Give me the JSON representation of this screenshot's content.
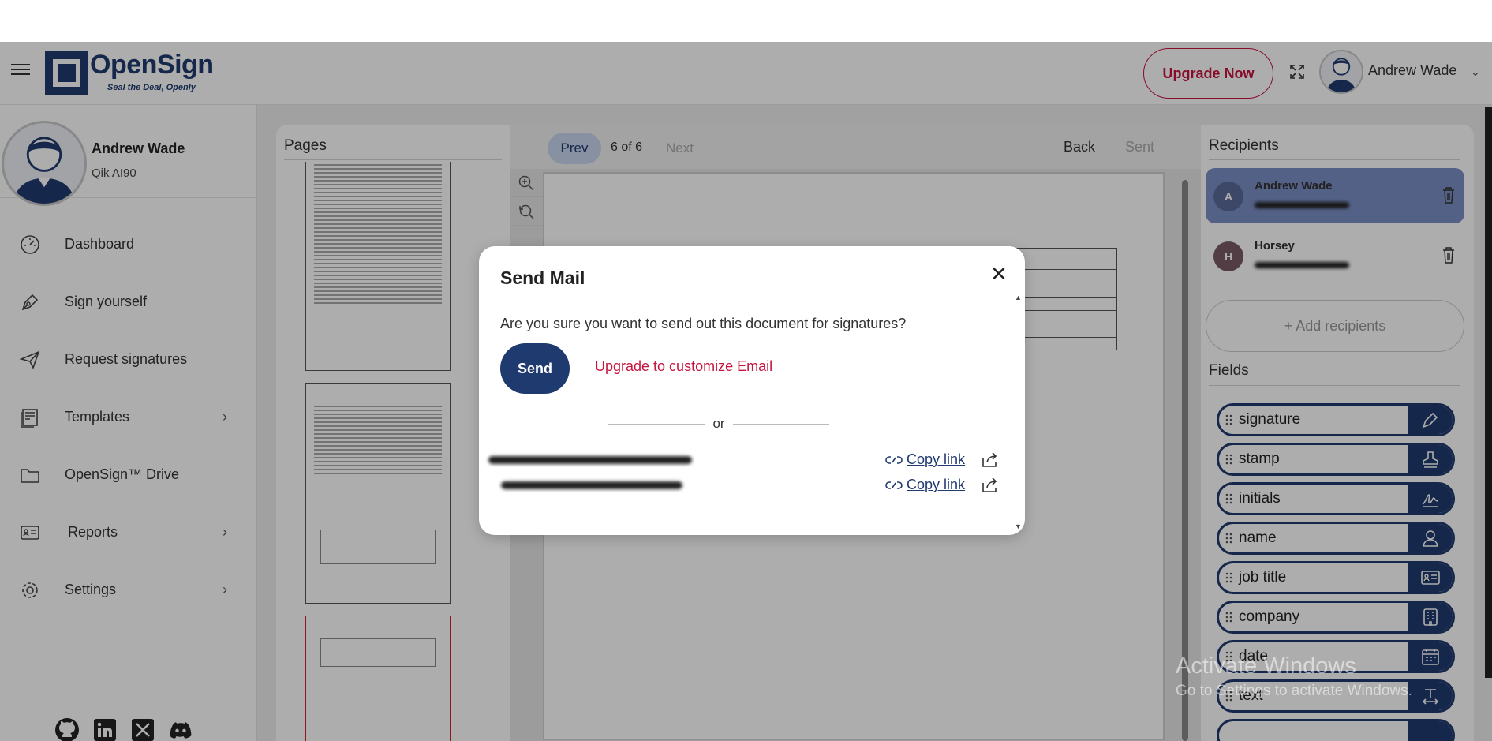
{
  "app": {
    "logo_text": "OpenSign",
    "logo_tagline": "Seal the Deal, Openly"
  },
  "header": {
    "upgrade_label": "Upgrade Now",
    "user_name": "Andrew Wade"
  },
  "sidebar": {
    "profile_name": "Andrew Wade",
    "profile_org": "Qik AI90",
    "items": [
      {
        "label": "Dashboard"
      },
      {
        "label": "Sign yourself"
      },
      {
        "label": "Request signatures"
      },
      {
        "label": "Templates"
      },
      {
        "label": "OpenSign™ Drive"
      },
      {
        "label": "Reports"
      },
      {
        "label": "Settings"
      }
    ]
  },
  "pages_panel": {
    "title": "Pages"
  },
  "viewer": {
    "prev": "Prev",
    "page_indicator": "6 of 6",
    "next": "Next",
    "back": "Back",
    "sent": "Sent"
  },
  "recipients_panel": {
    "title": "Recipients",
    "recipients": [
      {
        "initial": "A",
        "name": "Andrew Wade",
        "color": "#5b6b9a"
      },
      {
        "initial": "H",
        "name": "Horsey",
        "color": "#7a5a66"
      }
    ],
    "add_label": "+ Add recipients",
    "fields_title": "Fields",
    "fields": [
      {
        "label": "signature",
        "icon": "pen-icon"
      },
      {
        "label": "stamp",
        "icon": "stamp-icon"
      },
      {
        "label": "initials",
        "icon": "signature-icon"
      },
      {
        "label": "name",
        "icon": "user-icon"
      },
      {
        "label": "job title",
        "icon": "id-card-icon"
      },
      {
        "label": "company",
        "icon": "building-icon"
      },
      {
        "label": "date",
        "icon": "calendar-icon"
      },
      {
        "label": "text",
        "icon": "text-icon"
      }
    ]
  },
  "modal": {
    "title": "Send Mail",
    "question": "Are you sure you want to send out this document for signatures?",
    "send_label": "Send",
    "upgrade_link": "Upgrade to customize Email",
    "or_label": "or",
    "copy_link_label": "Copy link"
  },
  "watermark": {
    "line1": "Activate Windows",
    "line2": "Go to Settings to activate Windows."
  },
  "colors": {
    "brand": "#1f3a6e",
    "accent": "#c7143f"
  }
}
